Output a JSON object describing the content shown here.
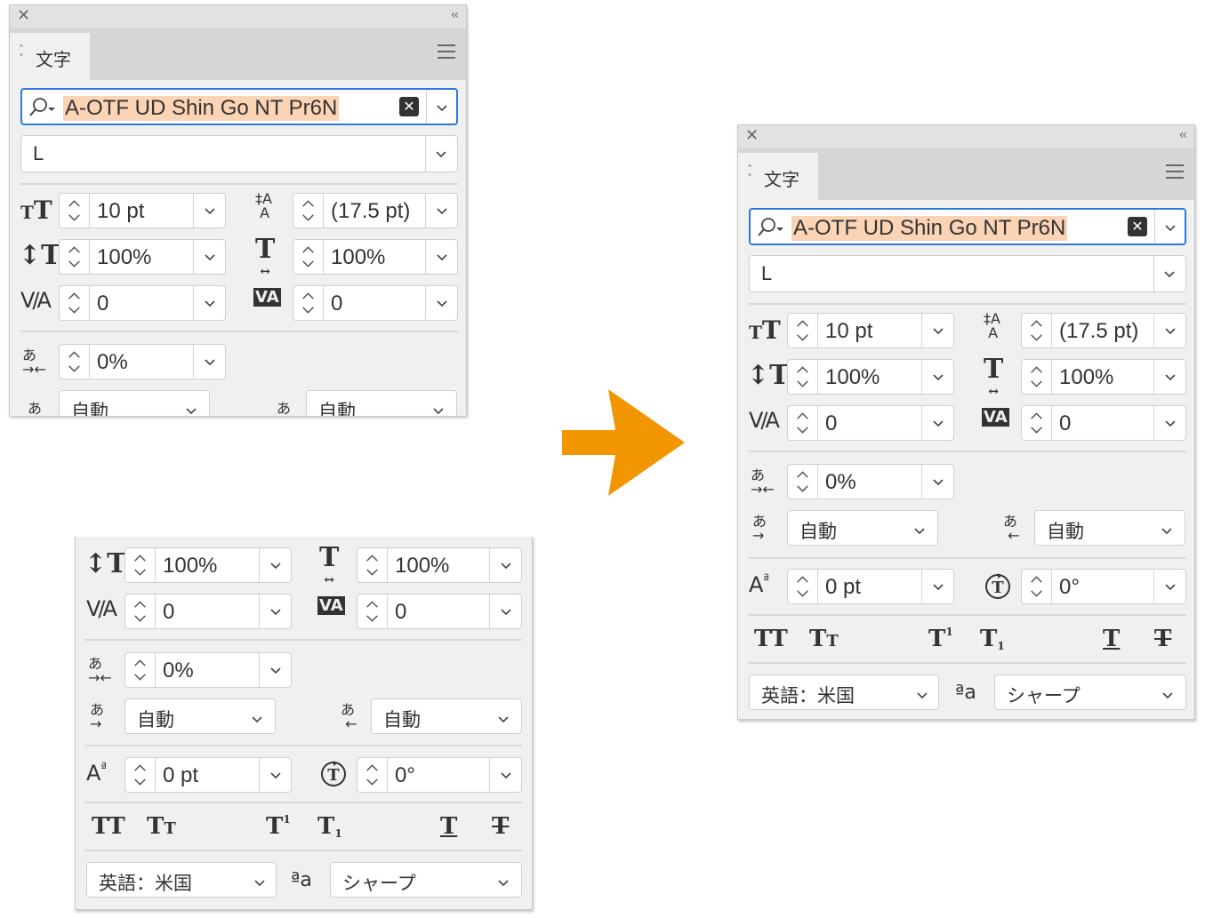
{
  "panel": {
    "tab_label": "文字",
    "font_name": "A-OTF UD Shin Go NT Pr6N",
    "font_style": "L",
    "font_size": "10 pt",
    "leading": "(17.5 pt)",
    "vertical_scale": "100%",
    "horizontal_scale": "100%",
    "kerning": "0",
    "tracking": "0",
    "tsume": "0%",
    "aki_left": "自動",
    "aki_right": "自動",
    "baseline_shift": "0 pt",
    "rotation": "0°",
    "language": "英語：米国",
    "antialias": "シャープ",
    "aa_label": "ªa"
  },
  "colors": {
    "accent_arrow": "#f29600",
    "focus_blue": "#2d7ad6",
    "highlight": "#fbd3b5",
    "panel_bg": "#f0f0f0"
  },
  "icons": [
    "close-icon",
    "collapse-icon",
    "menu-icon",
    "search-icon",
    "clear-icon",
    "chevron-down-icon",
    "font-size-icon",
    "leading-icon",
    "vertical-scale-icon",
    "horizontal-scale-icon",
    "kerning-icon",
    "tracking-icon",
    "tsume-icon",
    "aki-left-icon",
    "aki-right-icon",
    "baseline-shift-icon",
    "rotation-icon",
    "all-caps-icon",
    "small-caps-icon",
    "superscript-icon",
    "subscript-icon",
    "underline-icon",
    "strikethrough-icon",
    "arrow-right-icon"
  ]
}
